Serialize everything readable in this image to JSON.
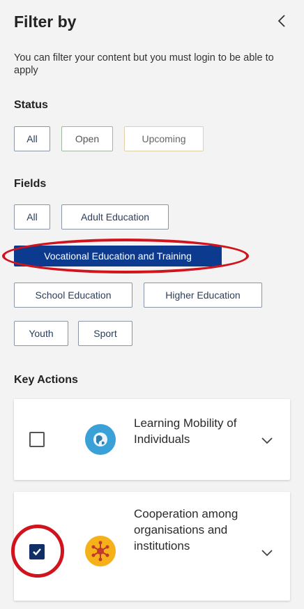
{
  "header": {
    "title": "Filter by"
  },
  "description": "You can filter your content but you must login to be able to apply",
  "status": {
    "label": "Status",
    "options": [
      "All",
      "Open",
      "Upcoming"
    ]
  },
  "fields": {
    "label": "Fields",
    "options": [
      "All",
      "Adult Education",
      "Vocational Education and Training",
      "School Education",
      "Higher Education",
      "Youth",
      "Sport"
    ],
    "selected": "Vocational Education and Training"
  },
  "key_actions": {
    "label": "Key Actions",
    "items": [
      {
        "label": "Learning Mobility of Individuals",
        "checked": false,
        "icon": "globe-icon"
      },
      {
        "label": "Cooperation among organisations and institutions",
        "checked": true,
        "icon": "network-icon"
      }
    ]
  },
  "colors": {
    "selected_chip": "#0b3a8f",
    "annotation_red": "#d0131c",
    "checkbox_checked": "#0f2f66"
  }
}
